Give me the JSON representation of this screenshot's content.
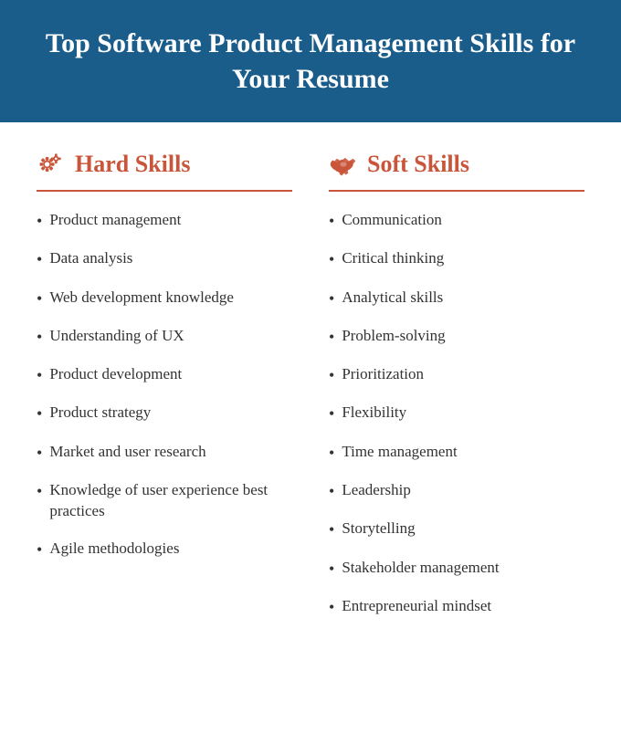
{
  "header": {
    "title": "Top Software Product Management Skills for Your Resume",
    "bg_color": "#1a5c8a"
  },
  "hard_skills": {
    "section_title": "Hard Skills",
    "icon_label": "gear-icon",
    "accent_color": "#c9553a",
    "items": [
      "Product management",
      "Data analysis",
      "Web development knowledge",
      "Understanding of UX",
      "Product development",
      "Product strategy",
      "Market and user research",
      "Knowledge of user experience best practices",
      "Agile methodologies"
    ]
  },
  "soft_skills": {
    "section_title": "Soft Skills",
    "icon_label": "handshake-icon",
    "accent_color": "#c9553a",
    "items": [
      "Communication",
      "Critical thinking",
      "Analytical skills",
      "Problem-solving",
      "Prioritization",
      "Flexibility",
      "Time management",
      "Leadership",
      "Storytelling",
      "Stakeholder management",
      "Entrepreneurial mindset"
    ]
  }
}
